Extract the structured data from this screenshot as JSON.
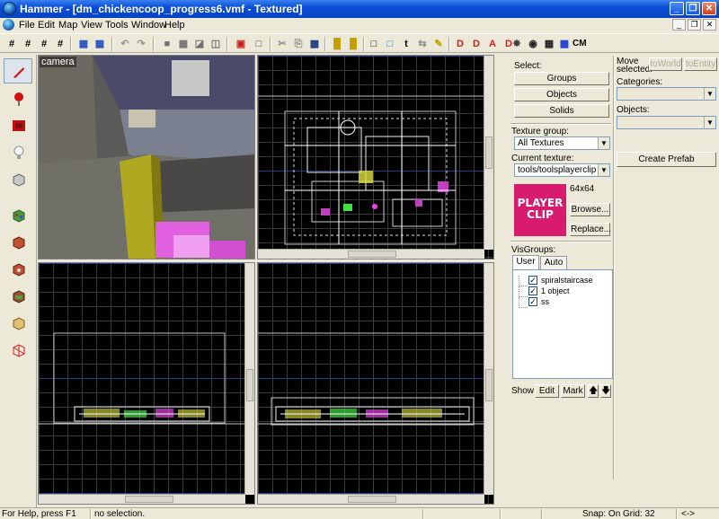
{
  "window": {
    "title": "Hammer - [dm_chickencoop_progress6.vmf - Textured]",
    "controls": [
      "_",
      "❐",
      "✕"
    ]
  },
  "menu": [
    "File",
    "Edit",
    "Map",
    "View",
    "Tools",
    "Window",
    "Help"
  ],
  "mdi_controls": [
    "_",
    "❐",
    "✕"
  ],
  "toolbar": {
    "cm_label": "CM"
  },
  "viewports": {
    "camera_label": "camera"
  },
  "select_group": {
    "label": "Select:",
    "buttons": [
      "Groups",
      "Objects",
      "Solids"
    ]
  },
  "move_group": {
    "label_line1": "Move",
    "label_line2": "selected:",
    "to_world": "toWorld",
    "to_entity": "toEntity",
    "categories_label": "Categories:",
    "objects_label": "Objects:",
    "create_prefab": "Create Prefab"
  },
  "texture": {
    "group_label": "Texture group:",
    "group_value": "All Textures",
    "current_label": "Current texture:",
    "current_value": "tools/toolsplayerclip",
    "preview_text_line1": "PLAYER",
    "preview_text_line2": "CLIP",
    "size": "64x64",
    "browse": "Browse...",
    "replace": "Replace..."
  },
  "visgroups": {
    "label": "VisGroups:",
    "tabs": [
      "User",
      "Auto"
    ],
    "items": [
      {
        "name": "spiralstaircase",
        "checked": true
      },
      {
        "name": "1 object",
        "checked": true
      },
      {
        "name": "ss",
        "checked": true
      }
    ],
    "show": "Show",
    "edit": "Edit",
    "mark": "Mark"
  },
  "status": {
    "help": "For Help, press F1",
    "selection": "no selection.",
    "snap": "Snap: On Grid: 32",
    "arrows": "<->"
  },
  "colors": {
    "title_bar": "#0a4fd6",
    "viewport_bg": "#000000",
    "grid_major": "#2a3a8a",
    "texture_preview": "#d81b6e"
  }
}
